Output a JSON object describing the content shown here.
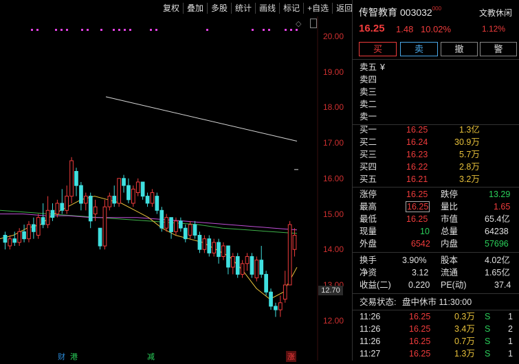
{
  "toolbar": {
    "items": [
      "复权",
      "叠加",
      "多股",
      "统计",
      "画线",
      "标记",
      "+自选",
      "返回"
    ]
  },
  "axis": {
    "labels": [
      "20.00",
      "19.00",
      "18.00",
      "17.00",
      "16.00",
      "15.00",
      "14.00",
      "13.00",
      "12.00"
    ],
    "current_price_tag": "12.70"
  },
  "events": [
    {
      "label": "财",
      "color": "#2a8ad8"
    },
    {
      "label": "港",
      "color": "#2ad05a"
    },
    {
      "label": "减",
      "color": "#2ad05a"
    },
    {
      "label": "涨",
      "color": "#f03c3c"
    }
  ],
  "stock": {
    "name": "传智教育",
    "code": "003032",
    "code_sup": "000",
    "price": "16.25",
    "change": "1.48",
    "change_pct": "10.02%",
    "index_name": "文教休闲",
    "index_pct": "1.12%"
  },
  "trade_buttons": {
    "buy": "买",
    "sell": "卖",
    "cancel": "撤",
    "warn": "警"
  },
  "asks": [
    {
      "label": "卖五",
      "extra": "¥",
      "price": "",
      "vol": ""
    },
    {
      "label": "卖四",
      "extra": "",
      "price": "",
      "vol": ""
    },
    {
      "label": "卖三",
      "extra": "",
      "price": "",
      "vol": ""
    },
    {
      "label": "卖二",
      "extra": "",
      "price": "",
      "vol": ""
    },
    {
      "label": "卖一",
      "extra": "",
      "price": "",
      "vol": ""
    }
  ],
  "bids": [
    {
      "label": "买一",
      "price": "16.25",
      "vol": "1.3亿"
    },
    {
      "label": "买二",
      "price": "16.24",
      "vol": "30.9万"
    },
    {
      "label": "买三",
      "price": "16.23",
      "vol": "5.7万"
    },
    {
      "label": "买四",
      "price": "16.22",
      "vol": "2.8万"
    },
    {
      "label": "买五",
      "price": "16.21",
      "vol": "3.2万"
    }
  ],
  "quote": [
    {
      "l1": "涨停",
      "v1": "16.25",
      "c1": "red",
      "l2": "跌停",
      "v2": "13.29",
      "c2": "grn"
    },
    {
      "l1": "最高",
      "v1": "16.25",
      "c1": "red",
      "l2": "量比",
      "v2": "1.65",
      "c2": "red"
    },
    {
      "l1": "最低",
      "v1": "16.25",
      "c1": "red",
      "l2": "市值",
      "v2": "65.4亿",
      "c2": "wht"
    },
    {
      "l1": "现量",
      "v1": "10",
      "c1": "grn",
      "l2": "总量",
      "v2": "64238",
      "c2": "wht"
    },
    {
      "l1": "外盘",
      "v1": "6542",
      "c1": "red",
      "l2": "内盘",
      "v2": "57696",
      "c2": "grn"
    }
  ],
  "fundamentals": [
    {
      "l1": "换手",
      "v1": "3.90%",
      "l2": "股本",
      "v2": "4.02亿"
    },
    {
      "l1": "净资",
      "v1": "3.12",
      "l2": "流通",
      "v2": "1.65亿"
    },
    {
      "l1": "收益(二)",
      "v1": "0.220",
      "l2": "PE(动)",
      "v2": "37.4"
    }
  ],
  "status": {
    "label": "交易状态:",
    "value": "盘中休市 11:30:00"
  },
  "ticks": [
    {
      "time": "11:26",
      "price": "16.25",
      "vol": "0.3万",
      "side": "S",
      "n": "1"
    },
    {
      "time": "11:26",
      "price": "16.25",
      "vol": "3.4万",
      "side": "S",
      "n": "2"
    },
    {
      "time": "11:26",
      "price": "16.25",
      "vol": "0.7万",
      "side": "S",
      "n": "1"
    },
    {
      "time": "11:27",
      "price": "16.25",
      "vol": "1.3万",
      "side": "S",
      "n": "1"
    }
  ],
  "chart_data": {
    "type": "candlestick",
    "y_range": [
      11.9,
      20.3
    ],
    "candles": [
      [
        14.4,
        14.2,
        14.5,
        14.0
      ],
      [
        14.1,
        14.3,
        14.4,
        14.0
      ],
      [
        14.3,
        14.2,
        14.5,
        14.1
      ],
      [
        14.2,
        14.5,
        14.6,
        14.1
      ],
      [
        14.5,
        14.3,
        14.7,
        14.2
      ],
      [
        14.3,
        14.7,
        14.8,
        14.2
      ],
      [
        14.7,
        14.5,
        14.9,
        14.3
      ],
      [
        14.4,
        14.9,
        15.0,
        14.3
      ],
      [
        14.9,
        14.7,
        15.3,
        14.6
      ],
      [
        14.7,
        15.1,
        15.5,
        14.6
      ],
      [
        15.1,
        14.9,
        15.3,
        14.8
      ],
      [
        15.0,
        15.3,
        15.4,
        14.9
      ],
      [
        15.3,
        15.1,
        15.7,
        15.0
      ],
      [
        15.1,
        15.5,
        15.8,
        15.0
      ],
      [
        15.5,
        16.5,
        16.6,
        15.3
      ],
      [
        16.2,
        15.8,
        16.3,
        15.5
      ],
      [
        15.8,
        15.3,
        15.9,
        15.1
      ],
      [
        15.3,
        15.5,
        15.6,
        15.1
      ],
      [
        15.5,
        14.8,
        15.6,
        14.6
      ],
      [
        15.0,
        15.2,
        15.4,
        14.8
      ],
      [
        14.6,
        14.1,
        14.6,
        14.0
      ],
      [
        14.1,
        15.2,
        15.4,
        14.0
      ],
      [
        15.2,
        15.5,
        15.6,
        15.1
      ],
      [
        15.5,
        15.3,
        15.8,
        15.2
      ],
      [
        15.3,
        16.0,
        16.0,
        15.2
      ],
      [
        16.0,
        15.8,
        16.1,
        15.6
      ],
      [
        15.8,
        15.4,
        16.0,
        15.3
      ],
      [
        15.3,
        15.7,
        15.8,
        15.2
      ],
      [
        15.6,
        15.9,
        16.0,
        15.5
      ],
      [
        15.9,
        15.5,
        15.9,
        15.4
      ],
      [
        15.5,
        15.3,
        15.6,
        15.2
      ],
      [
        15.3,
        15.6,
        15.7,
        15.2
      ],
      [
        15.5,
        15.1,
        15.6,
        15.0
      ],
      [
        15.1,
        14.6,
        15.2,
        14.5
      ],
      [
        14.6,
        14.9,
        15.0,
        14.5
      ],
      [
        14.9,
        14.5,
        14.9,
        14.3
      ],
      [
        14.5,
        14.8,
        14.9,
        14.4
      ],
      [
        14.8,
        14.6,
        14.9,
        14.5
      ],
      [
        14.6,
        14.3,
        14.7,
        14.2
      ],
      [
        14.4,
        14.7,
        14.8,
        14.3
      ],
      [
        14.7,
        14.4,
        14.8,
        14.3
      ],
      [
        14.4,
        14.0,
        14.5,
        13.9
      ],
      [
        14.0,
        14.3,
        14.4,
        13.9
      ],
      [
        14.3,
        13.9,
        14.4,
        13.8
      ],
      [
        13.9,
        14.2,
        14.3,
        13.8
      ],
      [
        14.2,
        13.8,
        14.3,
        13.6
      ],
      [
        13.8,
        14.1,
        14.2,
        13.7
      ],
      [
        14.1,
        13.5,
        14.1,
        13.3
      ],
      [
        13.5,
        13.8,
        13.9,
        13.3
      ],
      [
        13.8,
        13.3,
        13.9,
        13.2
      ],
      [
        13.3,
        13.6,
        13.7,
        13.2
      ],
      [
        13.6,
        13.8,
        13.9,
        13.4
      ],
      [
        13.8,
        13.3,
        13.9,
        13.2
      ],
      [
        13.2,
        13.7,
        13.8,
        13.1
      ],
      [
        13.7,
        13.3,
        14.1,
        13.2
      ],
      [
        13.3,
        12.8,
        13.4,
        12.7
      ],
      [
        12.8,
        12.4,
        12.9,
        12.3
      ],
      [
        12.4,
        12.3,
        12.5,
        12.1
      ],
      [
        12.3,
        12.5,
        12.7,
        12.1
      ],
      [
        12.6,
        13.0,
        13.4,
        12.5
      ],
      [
        13.0,
        14.7,
        14.8,
        13.0
      ],
      [
        14.0,
        14.4,
        14.6,
        13.8
      ]
    ],
    "ma_white_start": [
      18.3,
      17.05
    ],
    "ma_yellow": [
      14.3,
      14.4,
      14.6,
      14.7,
      15.0,
      15.2,
      15.4,
      15.5,
      15.4,
      15.3,
      15.1,
      14.9,
      14.6,
      14.4,
      14.3,
      14.2,
      14.0,
      13.8,
      13.4,
      12.9,
      12.6,
      12.8,
      13.5
    ],
    "ma_purple": [
      15.0,
      15.0,
      14.95,
      14.95,
      14.9,
      14.9,
      14.9,
      14.85,
      14.8,
      14.75,
      14.7,
      14.65,
      14.6,
      14.55
    ],
    "ma_green": [
      15.1,
      15.05,
      15.0,
      14.95,
      14.9,
      14.85,
      14.8,
      14.75,
      14.7,
      14.6,
      14.55,
      14.5,
      14.45
    ],
    "signal_dots_row": "magenta dots at top of chart"
  }
}
